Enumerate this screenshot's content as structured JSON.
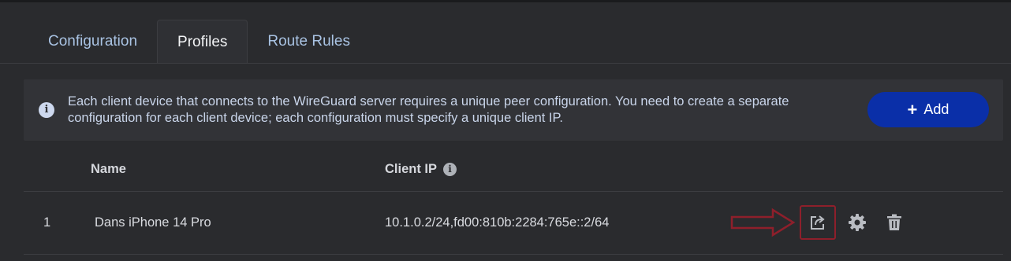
{
  "tabs": [
    {
      "label": "Configuration"
    },
    {
      "label": "Profiles"
    },
    {
      "label": "Route Rules"
    }
  ],
  "active_tab": "Profiles",
  "notice": {
    "text": "Each client device that connects to the WireGuard server requires a unique peer configuration. You need to create a separate configuration for each client device; each configuration must specify a unique client IP."
  },
  "add_button": {
    "label": "Add"
  },
  "table": {
    "columns": [
      {
        "label": "Name"
      },
      {
        "label": "Client IP"
      }
    ],
    "rows": [
      {
        "index": "1",
        "name": "Dans iPhone 14 Pro",
        "client_ip": "10.1.0.2/24,fd00:810b:2284:765e::2/64"
      }
    ]
  },
  "icons": {
    "info": "info-circle",
    "share": "export-share-icon",
    "settings": "gear-icon",
    "delete": "trash-icon",
    "annotation": "red-outline-arrow"
  },
  "colors": {
    "accent": "#0a2fa8",
    "highlight": "#8e1f2b",
    "background": "#2a2b2e"
  }
}
